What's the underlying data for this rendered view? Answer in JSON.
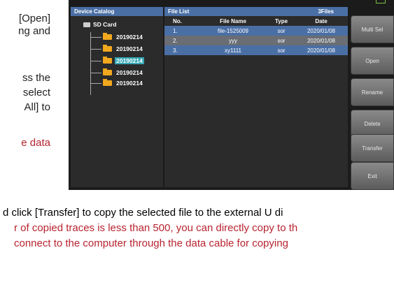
{
  "manual": {
    "left_lines": [
      "[Open]",
      "ng and",
      "ss the",
      "select",
      "All] to",
      "e data"
    ],
    "bottom_lines": [
      "d click [Transfer] to copy the selected file to the external U di",
      "r of copied traces is less than 500, you can directly copy to th",
      "connect to the computer through the data cable for copying"
    ]
  },
  "catalog": {
    "title": "Device Catalog",
    "root": "SD Card",
    "folders": [
      "20190214",
      "20190214",
      "20190214",
      "20190214",
      "20190214"
    ],
    "selected_index": 2
  },
  "filelist": {
    "title": "File List",
    "count": "3Files",
    "columns": [
      "No.",
      "File Name",
      "Type",
      "Date"
    ],
    "rows": [
      [
        "1.",
        "file-1525009",
        "sor",
        "2020/01/08"
      ],
      [
        "2.",
        "yyy",
        "sor",
        "2020/01/08"
      ],
      [
        "3.",
        "xy1111",
        "sor",
        "2020/01/08"
      ]
    ]
  },
  "buttons": [
    "Multi Sel",
    "Open",
    "Rename",
    "Delete",
    "Transfer",
    "Exit"
  ],
  "colors": {
    "header_blue": "#4a6fa5",
    "selected_cyan": "#35a7b4",
    "folder_orange": "#f2a81e",
    "manual_red": "#b8232f"
  }
}
